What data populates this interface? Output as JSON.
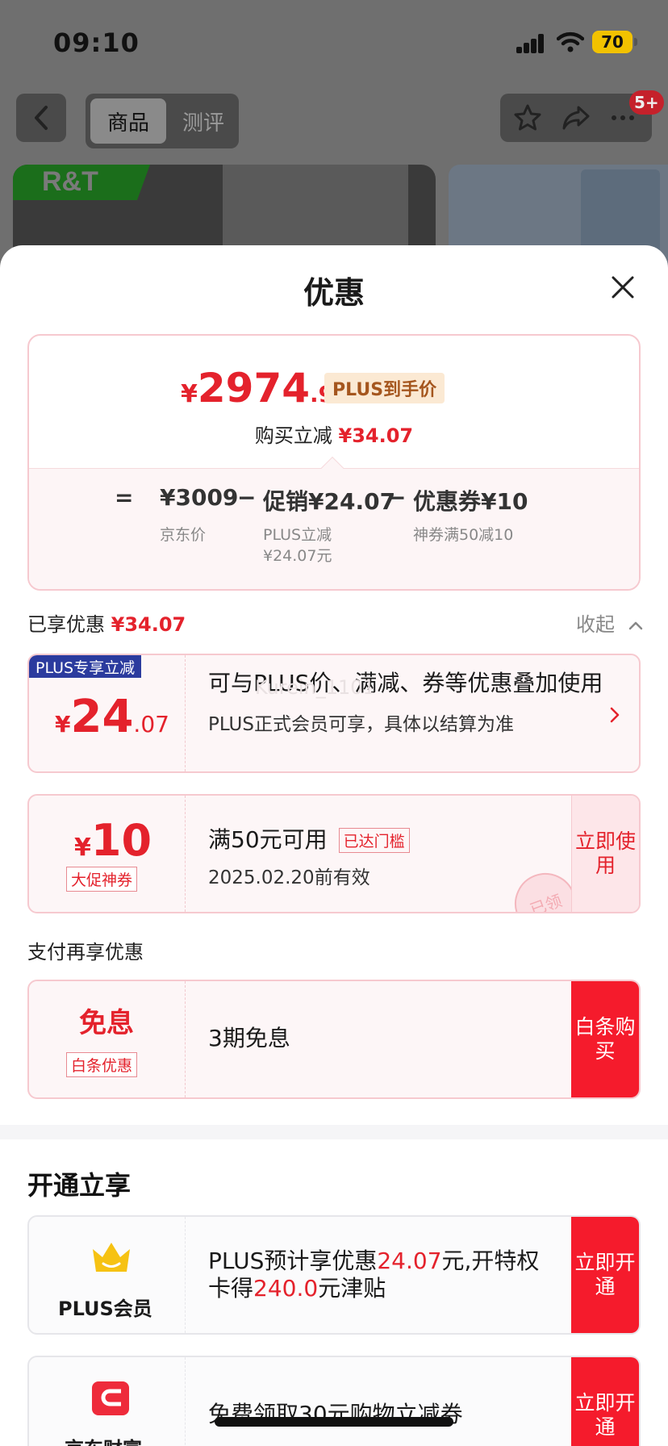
{
  "status_bar": {
    "time": "09:10",
    "battery": "70"
  },
  "nav": {
    "tab_active": "商品",
    "tab_other": "测评",
    "badge": "5+"
  },
  "background": {
    "brand": "R&T"
  },
  "sheet": {
    "title": "优惠",
    "summary": {
      "currency": "¥",
      "price_int": "2974",
      "price_dec": ".93",
      "plus_tag": "PLUS到手价",
      "reduce_label": "购买立减",
      "reduce_amount": "¥34.07",
      "formula": {
        "equals": "=",
        "jd_price": "¥3009",
        "minus1": "−",
        "promo": "促销¥24.07",
        "minus2": "−",
        "coupon": "优惠券¥10",
        "jd_price_label": "京东价",
        "promo_sub": "PLUS立减\n¥24.07元",
        "coupon_sub": "神券满50减10"
      }
    },
    "enjoyed_label": "已享优惠",
    "enjoyed_amount": "¥34.07",
    "collapse_label": "收起",
    "offers": [
      {
        "flag": "PLUS专享立减",
        "currency": "¥",
        "amount_int": "24",
        "amount_dec": ".07",
        "title": "可与PLUS价、满减、券等优惠叠加使用",
        "subtitle": "PLUS正式会员可享，具体以结算为准"
      },
      {
        "currency": "¥",
        "amount": "10",
        "tag": "大促神券",
        "title": "满50元可用",
        "status": "已达门槛",
        "validity": "2025.02.20前有效",
        "cta": "立即使用",
        "stamp": "已领"
      }
    ],
    "pay_title": "支付再享优惠",
    "pay_offer": {
      "big": "免息",
      "tag": "白条优惠",
      "text": "3期免息",
      "cta": "白条购买"
    },
    "open_title": "开通立享",
    "membership": {
      "name": "PLUS会员",
      "text_prefix": "PLUS预计享优惠",
      "amount1": "24.07",
      "text_mid": "元,开特权卡得",
      "amount2": "240.0",
      "text_suffix": "元津贴",
      "cta": "立即开通"
    },
    "finance": {
      "name": "京东财富",
      "text": "免费领取30元购物立减券",
      "cta": "立即开通"
    },
    "watermark": "Kurein_1101"
  }
}
